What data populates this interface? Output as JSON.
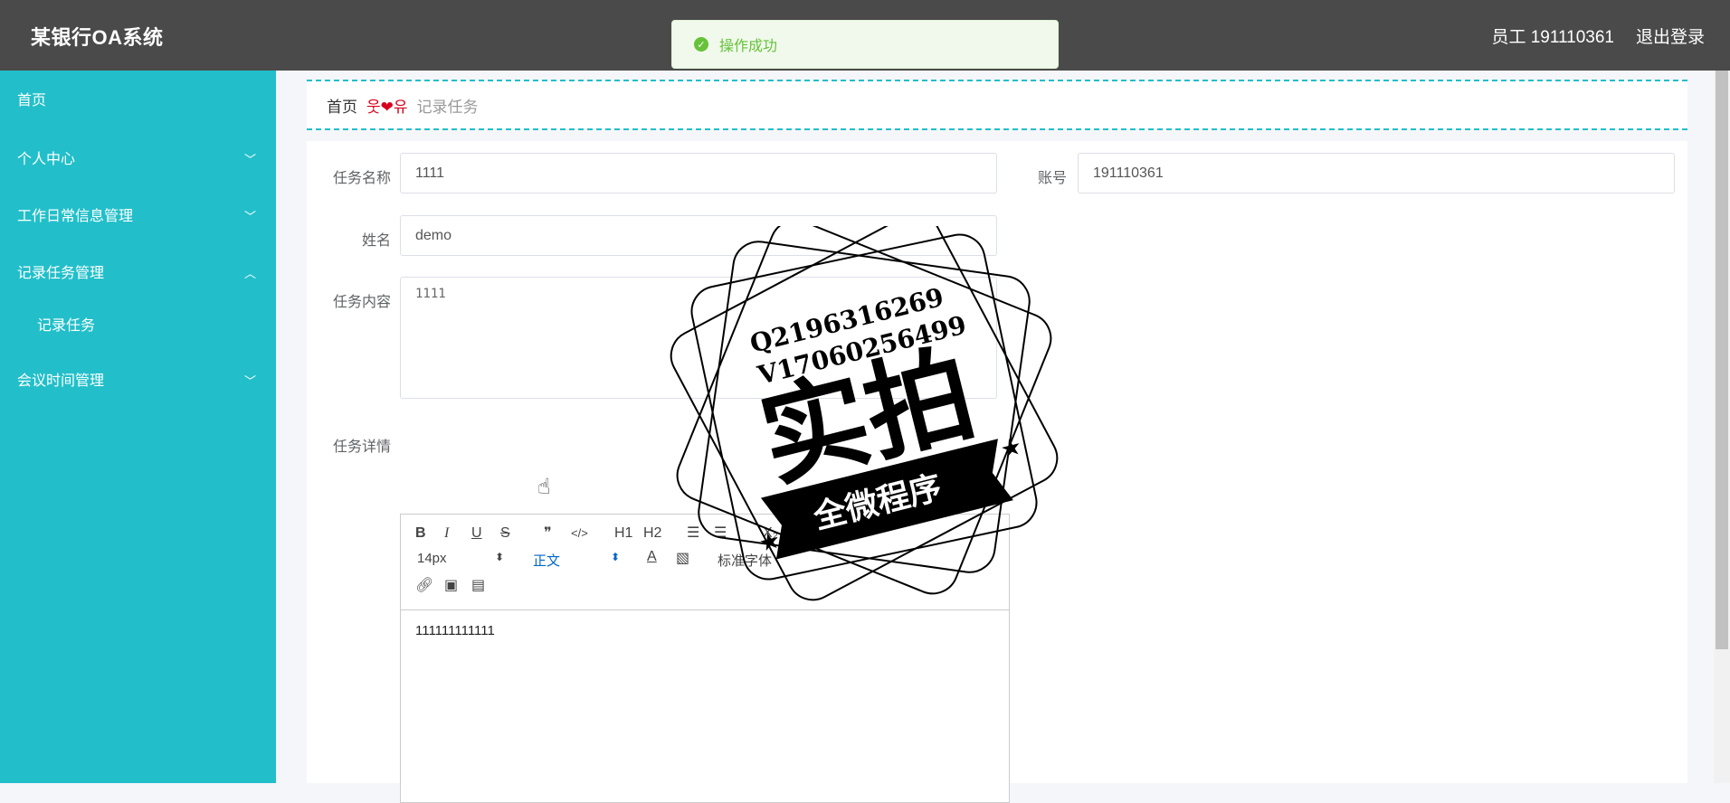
{
  "header": {
    "brand": "某银行OA系统",
    "user": "员工 191110361",
    "logout": "退出登录"
  },
  "toast": {
    "message": "操作成功"
  },
  "sidebar": {
    "items": [
      {
        "label": "首页"
      },
      {
        "label": "个人中心"
      },
      {
        "label": "工作日常信息管理"
      },
      {
        "label": "记录任务管理"
      },
      {
        "label": "记录任务"
      },
      {
        "label": "会议时间管理"
      }
    ]
  },
  "breadcrumb": {
    "home": "首页",
    "separator": "웃❤유",
    "current": "记录任务"
  },
  "form": {
    "task_name_label": "任务名称",
    "task_name_value": "1111",
    "account_label": "账号",
    "account_value": "191110361",
    "name_label": "姓名",
    "name_value": "demo",
    "content_label": "任务内容",
    "content_value": "1111",
    "detail_label": "任务详情",
    "detail_value": "111111111111"
  },
  "editor_toolbar": {
    "bold": "B",
    "italic": "I",
    "underline": "U",
    "strike": "S",
    "quote": "❞",
    "code": "</>",
    "h1": "H1",
    "h2": "H2",
    "sub": "X₂",
    "font_size": "14px",
    "header_select": "正文",
    "font_family": "标准字体"
  },
  "watermark": {
    "line1": "Q2196316269",
    "line2": "V17060256499",
    "big": "实拍",
    "ribbon": "全微程序"
  }
}
